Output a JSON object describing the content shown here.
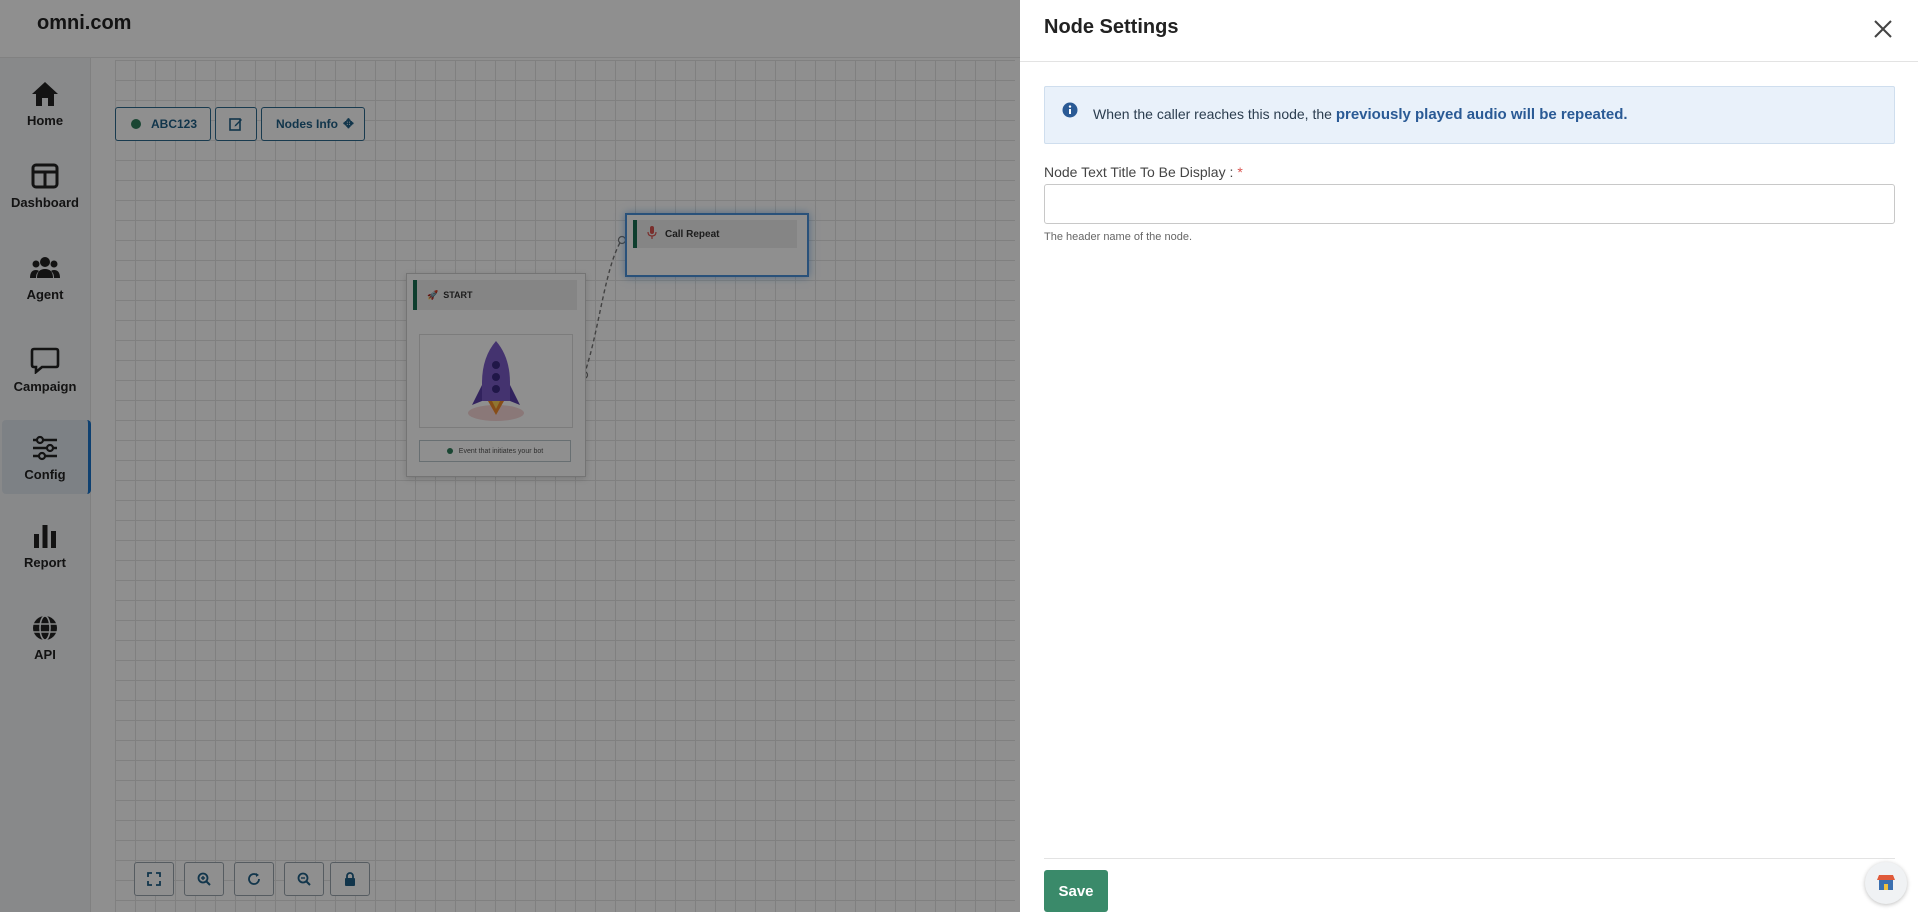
{
  "brand": "omni.com",
  "sidebar": {
    "items": [
      {
        "label": "Home",
        "icon": "home-icon"
      },
      {
        "label": "Dashboard",
        "icon": "dashboard-icon"
      },
      {
        "label": "Agent",
        "icon": "users-icon"
      },
      {
        "label": "Campaign",
        "icon": "chat-icon"
      },
      {
        "label": "Config",
        "icon": "sliders-icon",
        "active": true
      },
      {
        "label": "Report",
        "icon": "bar-chart-icon"
      },
      {
        "label": "API",
        "icon": "globe-icon"
      }
    ]
  },
  "toolbar": {
    "bot_name": "ABC123",
    "nodes_info_label": "Nodes Info",
    "status_color": "#2f7d5b"
  },
  "flow": {
    "start_node": {
      "title": "START",
      "event_label": "Event that initiates your bot"
    },
    "repeat_node": {
      "title": "Call Repeat"
    }
  },
  "drawer": {
    "title": "Node Settings",
    "info": {
      "prefix": "When the caller reaches this node, the ",
      "emphasis": "previously played audio will be repeated."
    },
    "field": {
      "label": "Node Text Title To Be Display :",
      "required_mark": "*",
      "value": "",
      "placeholder": "",
      "help": "The header name of the node."
    },
    "save_label": "Save"
  },
  "colors": {
    "accent": "#1a73c8",
    "save": "#3a8a6a",
    "node_stripe": "#1a6f52",
    "info_bg": "#e9f1fa"
  }
}
